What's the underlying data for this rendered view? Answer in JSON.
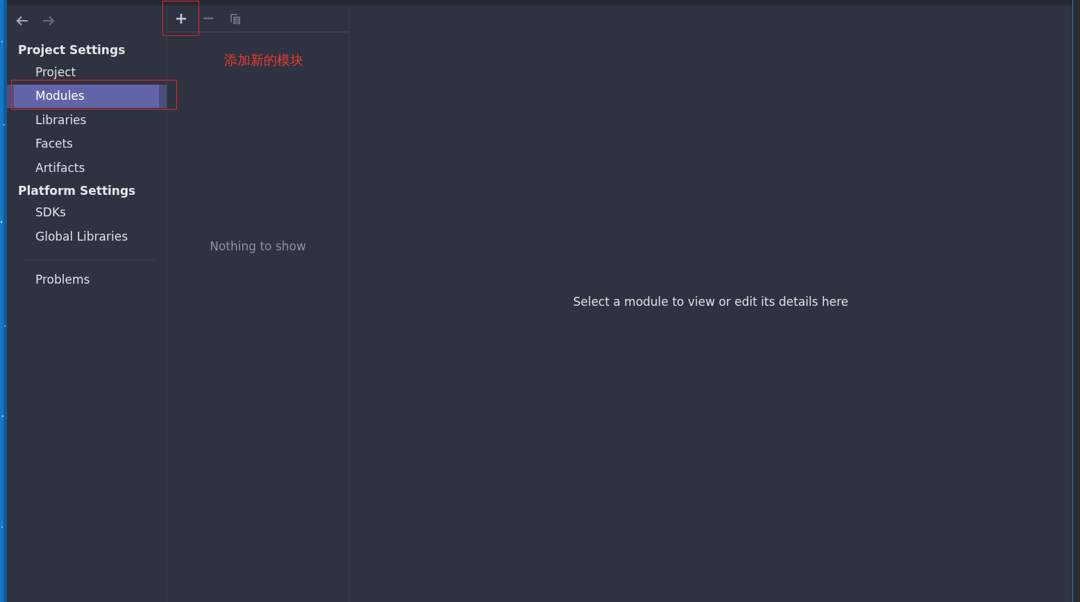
{
  "navigation": [
    {
      "kind": "back",
      "disabled": false
    },
    {
      "kind": "forward",
      "disabled": true
    }
  ],
  "sidebar": {
    "sections": [
      {
        "title": "Project Settings",
        "items": [
          {
            "label": "Project",
            "selected": false,
            "annotated": false
          },
          {
            "label": "Modules",
            "selected": true,
            "annotated": true
          },
          {
            "label": "Libraries",
            "selected": false,
            "annotated": false
          },
          {
            "label": "Facets",
            "selected": false,
            "annotated": false
          },
          {
            "label": "Artifacts",
            "selected": false,
            "annotated": false
          }
        ]
      },
      {
        "title": "Platform Settings",
        "items": [
          {
            "label": "SDKs",
            "selected": false,
            "annotated": false
          },
          {
            "label": "Global Libraries",
            "selected": false,
            "annotated": false
          }
        ]
      }
    ],
    "footer_items": [
      {
        "label": "Problems",
        "selected": false
      }
    ]
  },
  "module_list": {
    "toolbar": [
      {
        "kind": "add",
        "disabled": false,
        "annotated": true
      },
      {
        "kind": "remove",
        "disabled": true,
        "annotated": false
      },
      {
        "kind": "copy",
        "disabled": true,
        "annotated": false
      }
    ],
    "annotation": "添加新的模块",
    "empty_text": "Nothing to show"
  },
  "details": {
    "empty_text": "Select a module to view or edit its details here"
  }
}
